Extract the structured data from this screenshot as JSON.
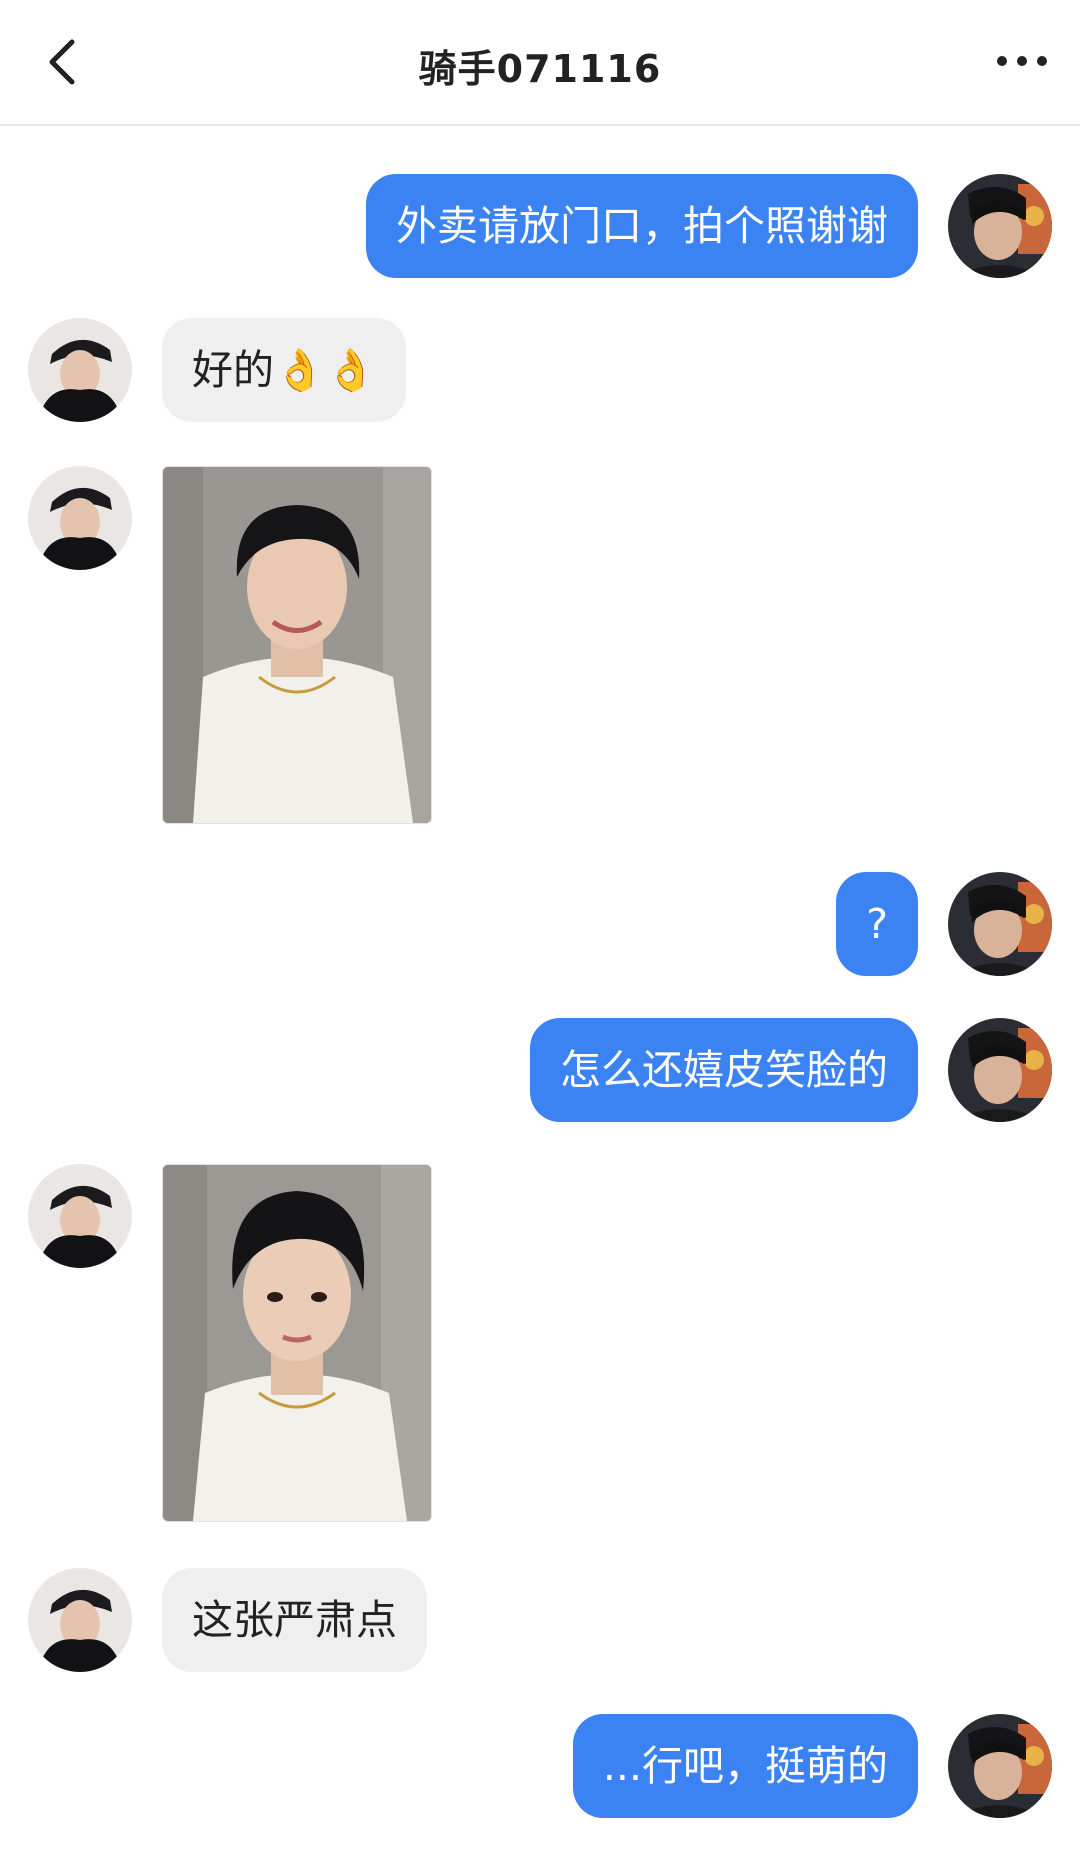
{
  "header": {
    "title": "骑手071116",
    "back_icon": "chevron-left-icon",
    "more_icon": "more-dots-icon"
  },
  "messages": [
    {
      "from": "me",
      "type": "text",
      "text": "外卖请放门口，拍个照谢谢"
    },
    {
      "from": "them",
      "type": "text",
      "text": "好的👌👌"
    },
    {
      "from": "them",
      "type": "image",
      "image": "smiling-selfie-photo"
    },
    {
      "from": "me",
      "type": "text",
      "text": "?"
    },
    {
      "from": "me",
      "type": "text",
      "text": "怎么还嬉皮笑脸的"
    },
    {
      "from": "them",
      "type": "image",
      "image": "serious-selfie-photo"
    },
    {
      "from": "them",
      "type": "text",
      "text": "这张严肃点"
    },
    {
      "from": "me",
      "type": "text",
      "text": "...行吧，挺萌的"
    }
  ],
  "colors": {
    "my_bubble": "#3b82f3",
    "their_bubble": "#efefef"
  }
}
